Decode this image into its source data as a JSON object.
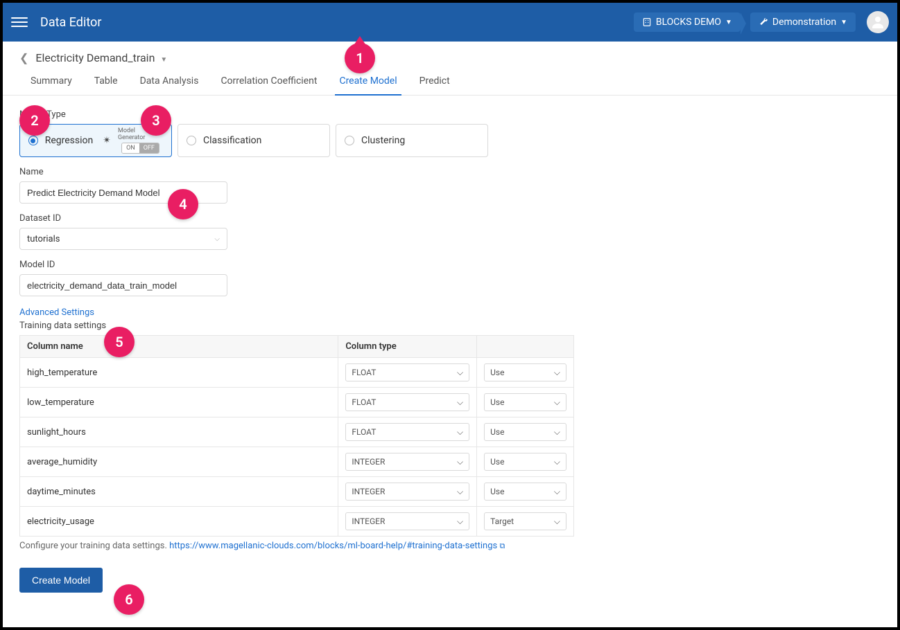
{
  "header": {
    "title": "Data Editor",
    "project_btn": "BLOCKS DEMO",
    "env_btn": "Demonstration"
  },
  "breadcrumb": {
    "title": "Electricity Demand_train"
  },
  "tabs": [
    {
      "label": "Summary"
    },
    {
      "label": "Table"
    },
    {
      "label": "Data Analysis"
    },
    {
      "label": "Correlation Coefficient"
    },
    {
      "label": "Create Model"
    },
    {
      "label": "Predict"
    }
  ],
  "model_type": {
    "section_label": "Model Type",
    "options": [
      {
        "label": "Regression"
      },
      {
        "label": "Classification"
      },
      {
        "label": "Clustering"
      }
    ],
    "model_gen_label": "Model Generator",
    "toggle_on": "ON",
    "toggle_off": "OFF"
  },
  "name": {
    "label": "Name",
    "value": "Predict Electricity Demand Model"
  },
  "dataset_id": {
    "label": "Dataset ID",
    "value": "tutorials"
  },
  "model_id": {
    "label": "Model ID",
    "value": "electricity_demand_data_train_model"
  },
  "advanced_link": "Advanced Settings",
  "training_data": {
    "label": "Training data settings",
    "headers": [
      "Column name",
      "Column type",
      ""
    ],
    "rows": [
      {
        "name": "high_temperature",
        "type": "FLOAT",
        "use": "Use"
      },
      {
        "name": "low_temperature",
        "type": "FLOAT",
        "use": "Use"
      },
      {
        "name": "sunlight_hours",
        "type": "FLOAT",
        "use": "Use"
      },
      {
        "name": "average_humidity",
        "type": "INTEGER",
        "use": "Use"
      },
      {
        "name": "daytime_minutes",
        "type": "INTEGER",
        "use": "Use"
      },
      {
        "name": "electricity_usage",
        "type": "INTEGER",
        "use": "Target"
      }
    ],
    "hint_prefix": "Configure your training data settings. ",
    "hint_link": "https://www.magellanic-clouds.com/blocks/ml-board-help/#training-data-settings"
  },
  "create_button": "Create Model",
  "badges": {
    "b1": "1",
    "b2": "2",
    "b3": "3",
    "b4": "4",
    "b5": "5",
    "b6": "6"
  }
}
